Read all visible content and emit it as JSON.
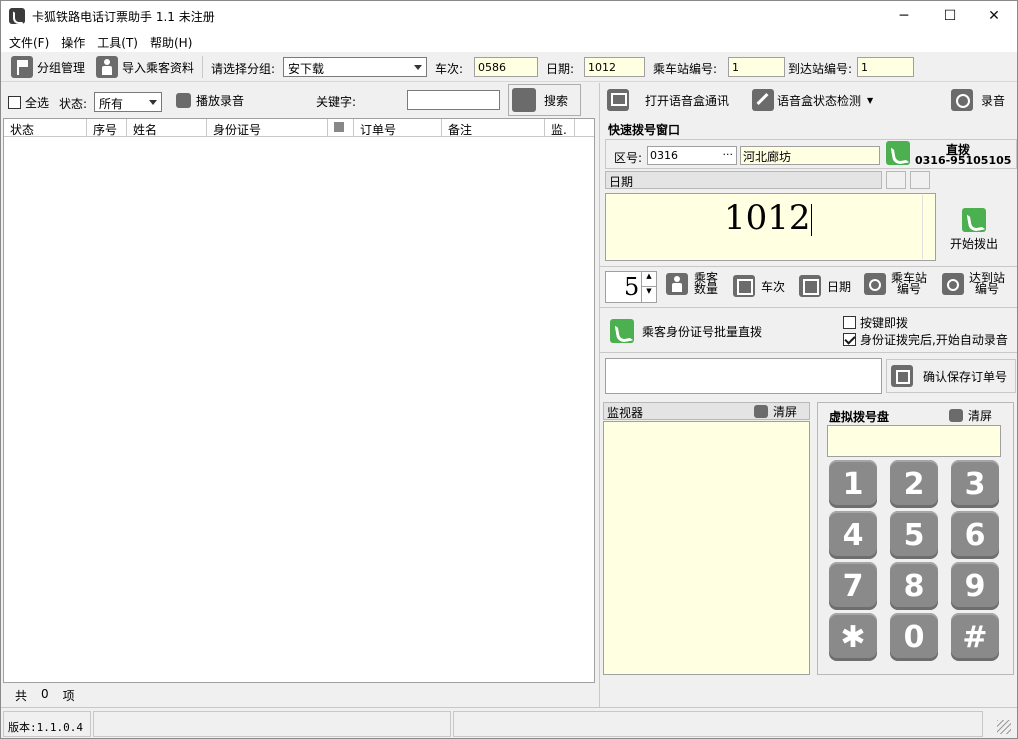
{
  "window": {
    "title": "卡狐铁路电话订票助手 1.1 未注册",
    "minimize": "─",
    "maximize": "☐",
    "close": "✕"
  },
  "menu": [
    "文件(F)",
    "操作",
    "工具(T)",
    "帮助(H)"
  ],
  "toolbar": {
    "group_manage": "分组管理",
    "import_passenger": "导入乘客资料",
    "select_group_label": "请选择分组:",
    "group_value": "安下载",
    "train_label": "车次:",
    "train_value": "0586",
    "date_label": "日期:",
    "date_value": "1012",
    "board_station_label": "乘车站编号:",
    "board_station_value": "1",
    "arrive_station_label": "到达站编号:",
    "arrive_station_value": "1"
  },
  "filter": {
    "select_all": "全选",
    "status_label": "状态:",
    "status_value": "所有",
    "play_recording": "播放录音",
    "keyword_label": "关键字:",
    "keyword_value": "",
    "search_button": "搜索"
  },
  "list": {
    "columns": [
      "状态",
      "序号",
      "姓名",
      "身份证号",
      "",
      "订单号",
      "备注",
      "监."
    ],
    "total_prefix": "共",
    "total_count": "0",
    "total_suffix": "项"
  },
  "voice": {
    "open_voice_box": "打开语音盒通讯",
    "voice_box_check": "语音盒状态检测",
    "record": "录音"
  },
  "quick_dial": {
    "title": "快速拨号窗口",
    "area_label": "区号:",
    "area_code": "0316",
    "area_more": "···",
    "area_name": "河北廊坊",
    "direct_dial_label": "直拨",
    "direct_dial_number": "0316-95105105",
    "field_label": "日期",
    "big_value": "1012",
    "start_dial": "开始拨出"
  },
  "quick_buttons": {
    "spinner_value": "5",
    "passenger_count": [
      "乘客",
      "数量"
    ],
    "train_no": "车次",
    "date": "日期",
    "board_station": [
      "乘车站",
      "编号"
    ],
    "arrive_station": [
      "达到站",
      "编号"
    ]
  },
  "batch": {
    "id_batch_dial": "乘客身份证号批量直拨",
    "dial_on_key": "按键即拨",
    "dial_on_key_checked": false,
    "auto_record": "身份证拨完后,开始自动录音",
    "auto_record_checked": true
  },
  "order": {
    "order_input": "",
    "confirm_save": "确认保存订单号"
  },
  "monitor": {
    "title": "监视器",
    "clear": "清屏"
  },
  "keypad": {
    "title": "虚拟拨号盘",
    "clear": "清屏",
    "display": "",
    "keys": [
      "1",
      "2",
      "3",
      "4",
      "5",
      "6",
      "7",
      "8",
      "9",
      "✱",
      "0",
      "#"
    ]
  },
  "statusbar": {
    "version": "版本:1.1.0.4"
  }
}
